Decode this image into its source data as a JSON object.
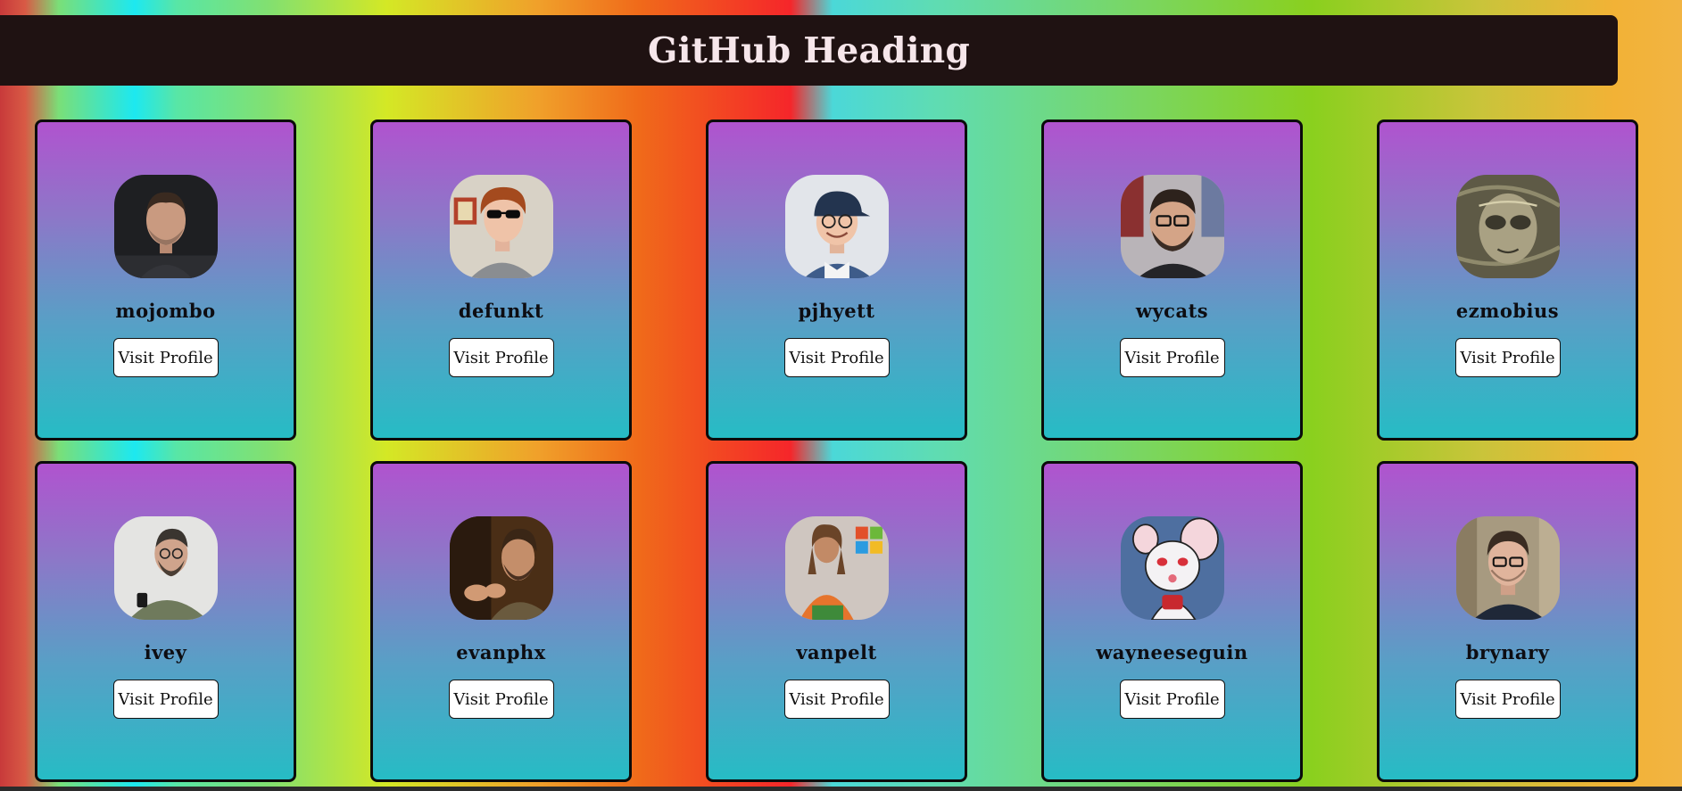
{
  "header": {
    "title": "GitHub Heading"
  },
  "cards": [
    {
      "username": "mojombo",
      "button_label": "Visit Profile",
      "avatar_icon": "bearded-man-portrait"
    },
    {
      "username": "defunkt",
      "button_label": "Visit Profile",
      "avatar_icon": "man-sunglasses-portrait"
    },
    {
      "username": "pjhyett",
      "button_label": "Visit Profile",
      "avatar_icon": "man-cap-glasses-portrait"
    },
    {
      "username": "wycats",
      "button_label": "Visit Profile",
      "avatar_icon": "bearded-man-glasses-portrait"
    },
    {
      "username": "ezmobius",
      "button_label": "Visit Profile",
      "avatar_icon": "alien-sketch-portrait"
    },
    {
      "username": "ivey",
      "button_label": "Visit Profile",
      "avatar_icon": "man-phone-portrait"
    },
    {
      "username": "evanphx",
      "button_label": "Visit Profile",
      "avatar_icon": "man-speaking-portrait"
    },
    {
      "username": "vanpelt",
      "button_label": "Visit Profile",
      "avatar_icon": "man-presenting-portrait"
    },
    {
      "username": "wayneeseguin",
      "button_label": "Visit Profile",
      "avatar_icon": "cartoon-mouse-portrait"
    },
    {
      "username": "brynary",
      "button_label": "Visit Profile",
      "avatar_icon": "man-glasses-portrait"
    }
  ],
  "colors": {
    "header_bg": "#1f1212",
    "header_text": "#f6e6ea",
    "card_top": "#b053cf",
    "card_bottom": "#26bcc5"
  }
}
